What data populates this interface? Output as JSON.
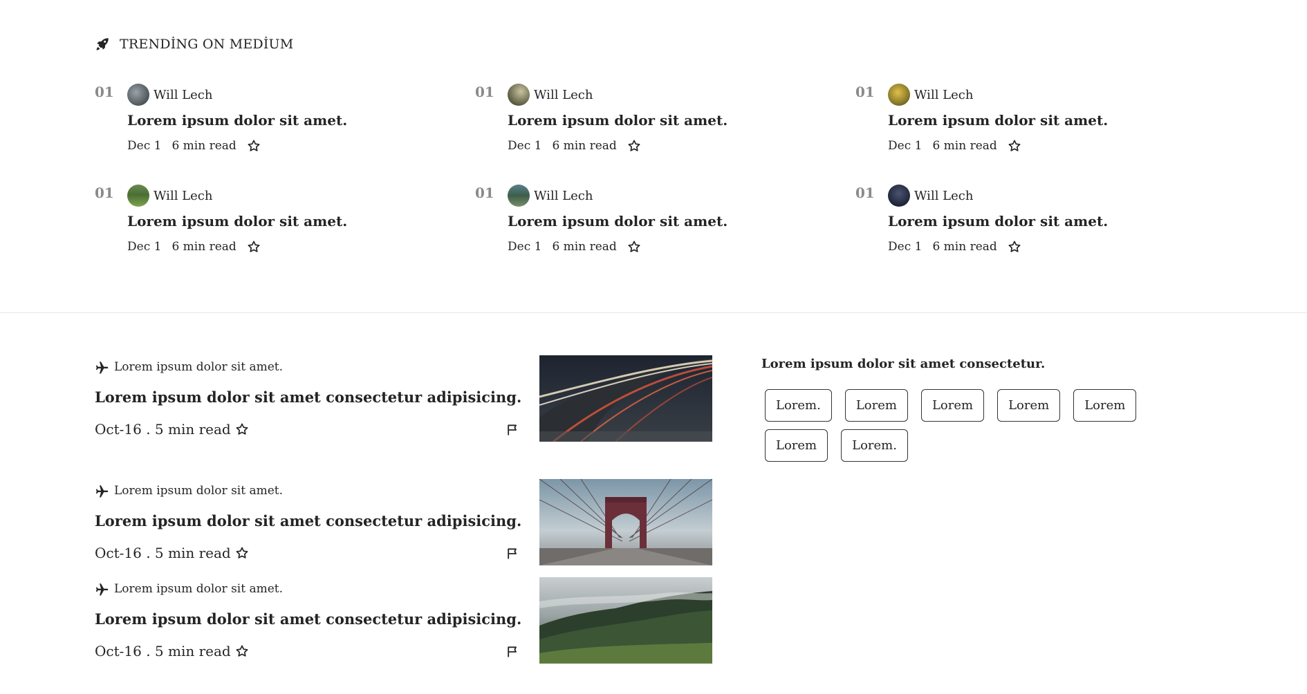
{
  "trending": {
    "title": "TRENDİNG ON MEDİUM",
    "icon": "rocket-icon",
    "items": [
      {
        "num": "01",
        "author": "Will Lech",
        "title": "Lorem ipsum dolor sit amet.",
        "date": "Dec 1",
        "read": "6 min read"
      },
      {
        "num": "01",
        "author": "Will Lech",
        "title": "Lorem ipsum dolor sit amet.",
        "date": "Dec 1",
        "read": "6 min read"
      },
      {
        "num": "01",
        "author": "Will Lech",
        "title": "Lorem ipsum dolor sit amet.",
        "date": "Dec 1",
        "read": "6 min read"
      },
      {
        "num": "01",
        "author": "Will Lech",
        "title": "Lorem ipsum dolor sit amet.",
        "date": "Dec 1",
        "read": "6 min read"
      },
      {
        "num": "01",
        "author": "Will Lech",
        "title": "Lorem ipsum dolor sit amet.",
        "date": "Dec 1",
        "read": "6 min read"
      },
      {
        "num": "01",
        "author": "Will Lech",
        "title": "Lorem ipsum dolor sit amet.",
        "date": "Dec 1",
        "read": "6 min read"
      }
    ]
  },
  "posts": [
    {
      "topic": "Lorem ipsum dolor sit amet.",
      "title": "Lorem ipsum dolor sit amet consectetur adipisicing.",
      "meta": "Oct-16 . 5 min read",
      "image": "traffic-light-trails"
    },
    {
      "topic": "Lorem ipsum dolor sit amet.",
      "title": "Lorem ipsum dolor sit amet consectetur adipisicing.",
      "meta": "Oct-16 . 5 min read",
      "image": "brooklyn-bridge"
    },
    {
      "topic": "Lorem ipsum dolor sit amet.",
      "title": "Lorem ipsum dolor sit amet consectetur adipisicing.",
      "meta": "Oct-16 . 5 min read",
      "image": "foggy-forest-hill"
    }
  ],
  "sidebar": {
    "title": "Lorem ipsum dolor sit amet consectetur.",
    "tags": [
      "Lorem.",
      "Lorem",
      "Lorem",
      "Lorem",
      "Lorem",
      "Lorem",
      "Lorem."
    ]
  },
  "colors": {
    "text": "#242424",
    "muted_number": "#8a8a8a",
    "divider": "#e6e6e6",
    "tag_border": "#333333"
  }
}
